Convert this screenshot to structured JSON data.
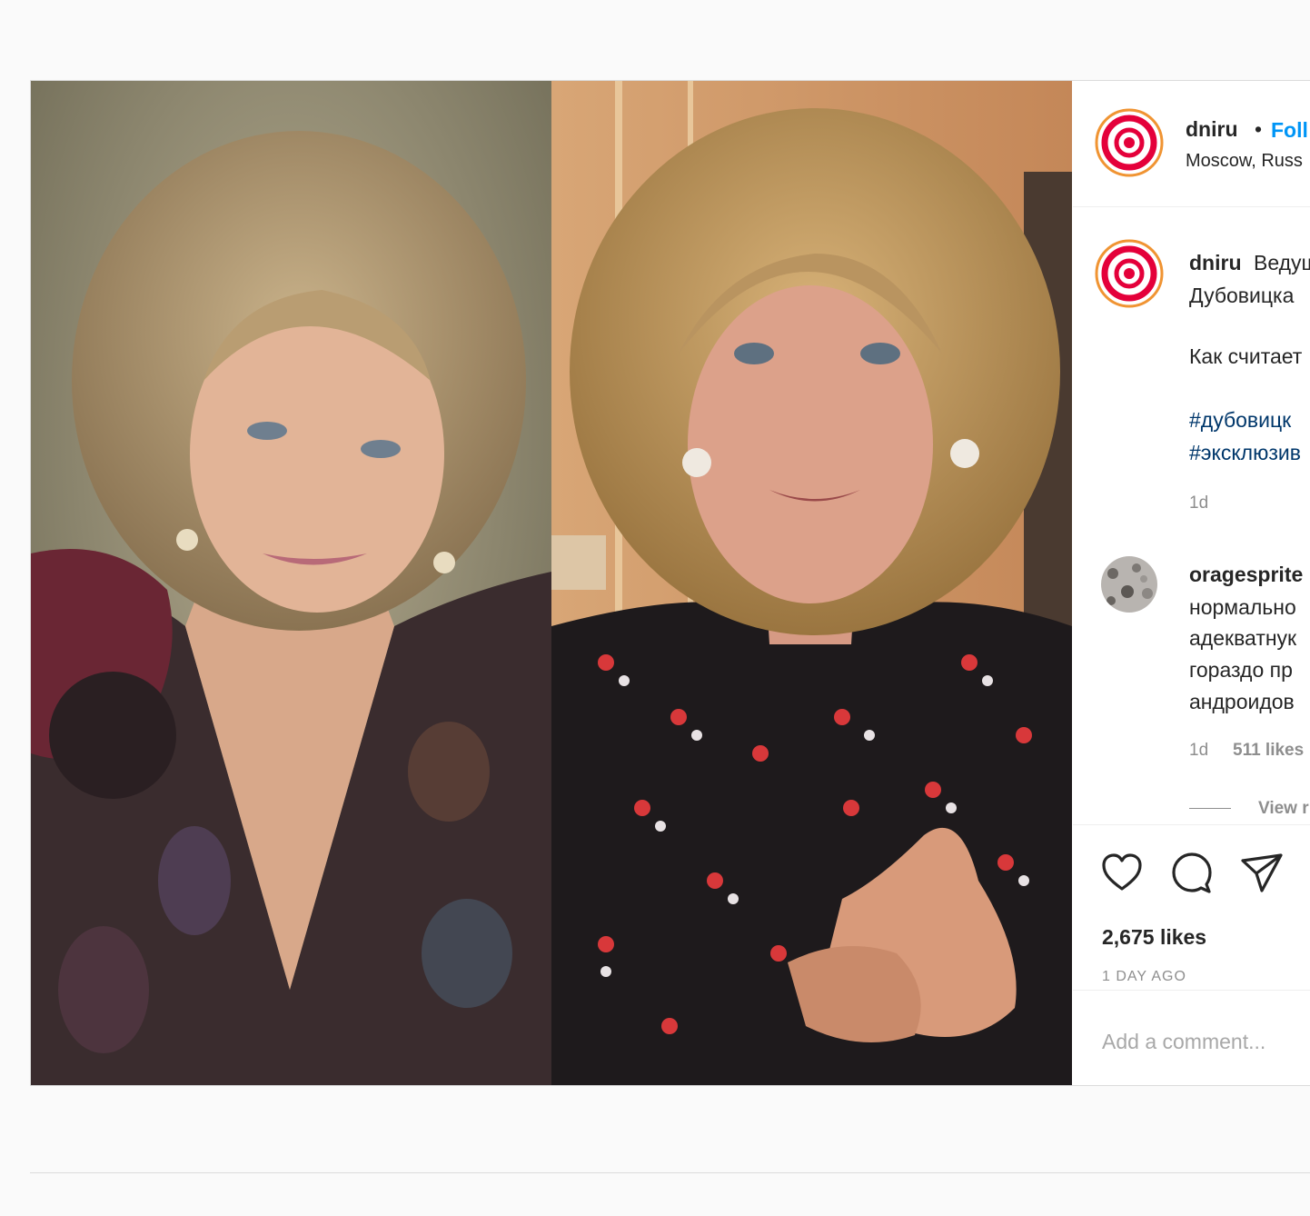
{
  "post": {
    "username": "dniru",
    "separator": "•",
    "follow_label": "Foll",
    "location": "Moscow, Russ"
  },
  "caption": {
    "username": "dniru",
    "line1": "Ведущ",
    "line2": "Дубовицка",
    "line3": "Как считает",
    "hashtag1": "#дубовицк",
    "hashtag2": "#эксклюзив",
    "time": "1d"
  },
  "comments": [
    {
      "username": "oragesprite",
      "lines": [
        "нормально",
        "адекватнук",
        "гораздо пр",
        "андроидов"
      ],
      "time": "1d",
      "likes": "511 likes",
      "view_replies": "View r"
    }
  ],
  "actions": {
    "like_icon": "heart-icon",
    "comment_icon": "comment-icon",
    "share_icon": "paper-plane-icon",
    "likes_total": "2,675 likes",
    "date": "1 DAY AGO"
  },
  "comment_box": {
    "placeholder": "Add a comment..."
  },
  "colors": {
    "follow": "#0095f6",
    "hashtag": "#00376b",
    "muted": "#8e8e8e",
    "avatar_ring": "#e4003a"
  }
}
